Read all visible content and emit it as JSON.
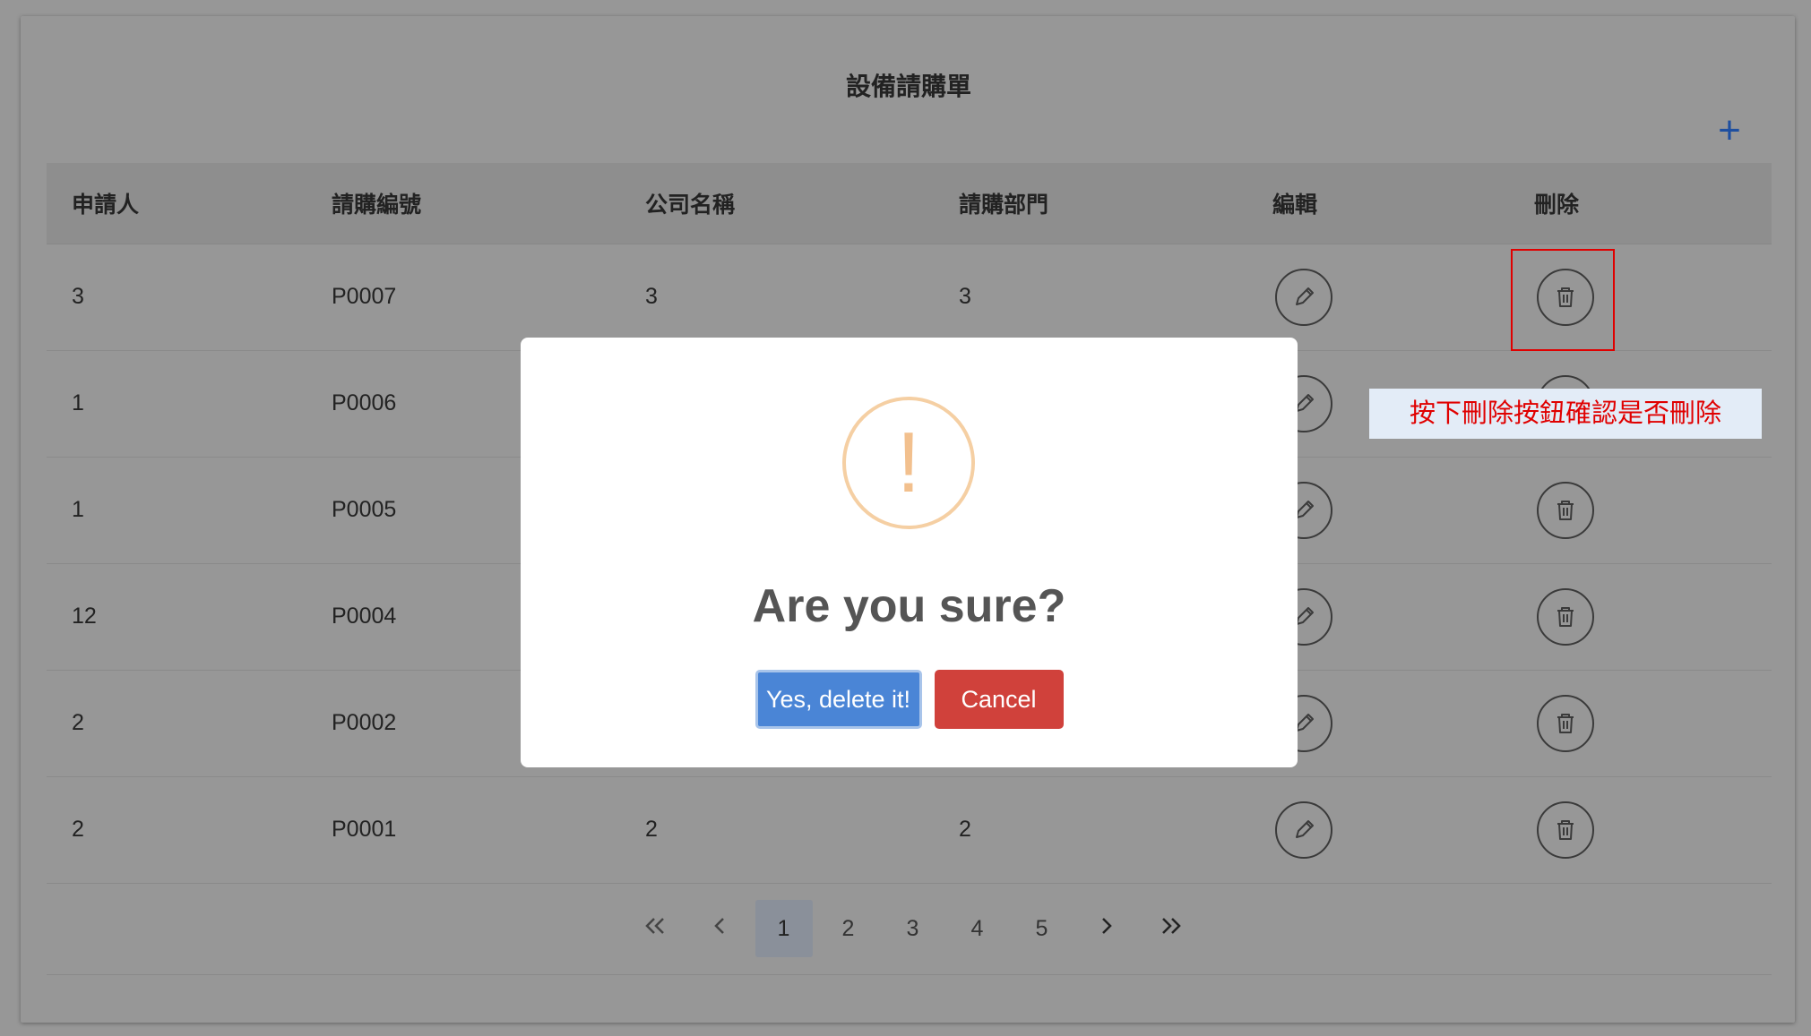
{
  "page": {
    "title": "設備請購單",
    "add_label": "+"
  },
  "table": {
    "headers": [
      "申請人",
      "請購編號",
      "公司名稱",
      "請購部門",
      "編輯",
      "刪除"
    ],
    "rows": [
      {
        "applicant": "3",
        "order_no": "P0007",
        "company": "3",
        "department": "3"
      },
      {
        "applicant": "1",
        "order_no": "P0006",
        "company": "",
        "department": ""
      },
      {
        "applicant": "1",
        "order_no": "P0005",
        "company": "",
        "department": ""
      },
      {
        "applicant": "12",
        "order_no": "P0004",
        "company": "",
        "department": ""
      },
      {
        "applicant": "2",
        "order_no": "P0002",
        "company": "",
        "department": ""
      },
      {
        "applicant": "2",
        "order_no": "P0001",
        "company": "2",
        "department": "2"
      }
    ]
  },
  "pagination": {
    "first": "«",
    "prev": "‹",
    "pages": [
      "1",
      "2",
      "3",
      "4",
      "5"
    ],
    "active": "1",
    "next": "›",
    "last": "»"
  },
  "callout": {
    "text": "按下刪除按鈕確認是否刪除"
  },
  "dialog": {
    "icon": "!",
    "title": "Are you sure?",
    "confirm_label": "Yes, delete it!",
    "cancel_label": "Cancel"
  },
  "colors": {
    "overlay": "#979797",
    "confirm": "#4a85d6",
    "cancel": "#d0413b",
    "warning": "#f2c08e",
    "annotation": "#e00000"
  }
}
